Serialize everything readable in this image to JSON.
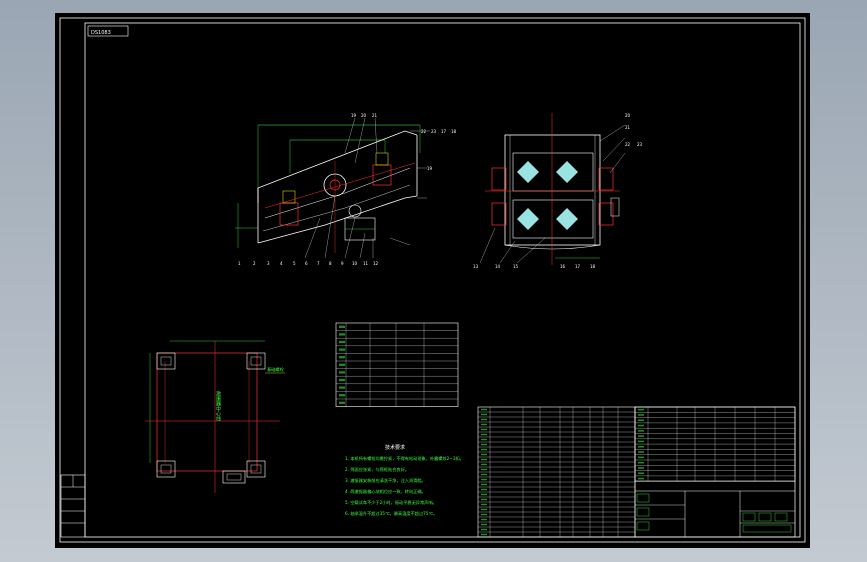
{
  "drawing": {
    "code_tag": "DS1083",
    "callouts_side_top": [
      "19",
      "20",
      "21",
      "22",
      "23",
      "17",
      "18",
      "19"
    ],
    "callouts_end_top": [
      "20",
      "21",
      "22",
      "23"
    ],
    "callouts_side_bottom": [
      "1",
      "2",
      "3",
      "4",
      "5",
      "6",
      "7",
      "8",
      "9",
      "10",
      "11",
      "12"
    ],
    "callouts_end_bottom": [
      "13",
      "14",
      "15",
      "16",
      "17",
      "18"
    ]
  },
  "tech_notes": {
    "title": "技术要求",
    "lines": [
      "1. 本机所有螺栓均需拧紧，不得有松动现象，外露螺纹2~3扣。",
      "2. 筛面应张紧，与筛框贴合良好。",
      "3. 激振器安装前应清洗干净，注入润滑脂。",
      "4. 两激振器偏心块相位应一致，转向正确。",
      "5. 空载试车不少于2小时，振动平稳无异常声响。",
      "6. 轴承温升不超过35℃，最高温度不超过75℃。",
      "7. 未注明公差按GB/T1804-m执行，表面涂漆。"
    ]
  },
  "foundation": {
    "label_right": "基础螺栓",
    "vertical_text": "激振器中心线"
  }
}
